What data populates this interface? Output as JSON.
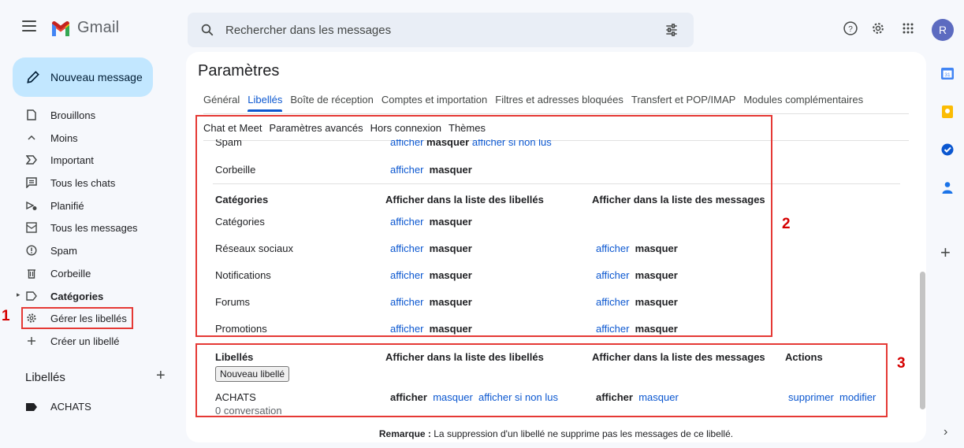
{
  "app": {
    "name": "Gmail"
  },
  "search": {
    "placeholder": "Rechercher dans les messages"
  },
  "header": {
    "avatar_letter": "R"
  },
  "compose": {
    "label": "Nouveau message"
  },
  "sidebar": {
    "items": [
      {
        "label": "Brouillons",
        "icon": "draft-icon"
      },
      {
        "label": "Moins",
        "icon": "chevron-up-icon"
      },
      {
        "label": "Important",
        "icon": "important-icon"
      },
      {
        "label": "Tous les chats",
        "icon": "chat-icon"
      },
      {
        "label": "Planifié",
        "icon": "scheduled-icon"
      },
      {
        "label": "Tous les messages",
        "icon": "all-mail-icon"
      },
      {
        "label": "Spam",
        "icon": "spam-icon"
      },
      {
        "label": "Corbeille",
        "icon": "trash-icon"
      },
      {
        "label": "Catégories",
        "icon": "label-outline-icon"
      },
      {
        "label": "Gérer les libellés",
        "icon": "gear-icon"
      },
      {
        "label": "Créer un libellé",
        "icon": "plus-icon"
      }
    ],
    "labels_heading": "Libellés",
    "labels": [
      {
        "label": "ACHATS"
      }
    ]
  },
  "annotations": {
    "one": "1",
    "two": "2",
    "three": "3"
  },
  "settings": {
    "title": "Paramètres",
    "tabs": [
      "Général",
      "Libellés",
      "Boîte de réception",
      "Comptes et importation",
      "Filtres et adresses bloquées",
      "Transfert et POP/IMAP",
      "Modules complémentaires"
    ],
    "active_tab": "Libellés",
    "tabs2": [
      "Chat et Meet",
      "Paramètres avancés",
      "Hors connexion",
      "Thèmes"
    ],
    "system_rows": [
      {
        "name": "Spam",
        "show": "afficher",
        "hide": "masquer",
        "unread": "afficher si non lus"
      },
      {
        "name": "Corbeille",
        "show": "afficher",
        "hide": "masquer"
      }
    ],
    "categories_header": {
      "col1": "Catégories",
      "col2": "Afficher dans la liste des libellés",
      "col3": "Afficher dans la liste des messages"
    },
    "category_rows": [
      {
        "name": "Catégories",
        "l_show": "afficher",
        "l_hide": "masquer"
      },
      {
        "name": "Réseaux sociaux",
        "l_show": "afficher",
        "l_hide": "masquer",
        "m_show": "afficher",
        "m_hide": "masquer"
      },
      {
        "name": "Notifications",
        "l_show": "afficher",
        "l_hide": "masquer",
        "m_show": "afficher",
        "m_hide": "masquer"
      },
      {
        "name": "Forums",
        "l_show": "afficher",
        "l_hide": "masquer",
        "m_show": "afficher",
        "m_hide": "masquer"
      },
      {
        "name": "Promotions",
        "l_show": "afficher",
        "l_hide": "masquer",
        "m_show": "afficher",
        "m_hide": "masquer"
      }
    ],
    "labels_header": {
      "col1": "Libellés",
      "col2": "Afficher dans la liste des libellés",
      "col3": "Afficher dans la liste des messages",
      "col4": "Actions"
    },
    "new_label_button": "Nouveau libellé",
    "user_labels": [
      {
        "name": "ACHATS",
        "count": "0 conversation",
        "l_show": "afficher",
        "l_hide": "masquer",
        "l_unread": "afficher si non lus",
        "m_show": "afficher",
        "m_hide": "masquer",
        "delete": "supprimer",
        "edit": "modifier"
      }
    ],
    "note_bold": "Remarque :",
    "note_text": " La suppression d'un libellé ne supprime pas les messages de ce libellé."
  },
  "colors": {
    "accent": "#0b57d0",
    "compose_bg": "#c2e7ff",
    "highlight": "#e53935"
  }
}
